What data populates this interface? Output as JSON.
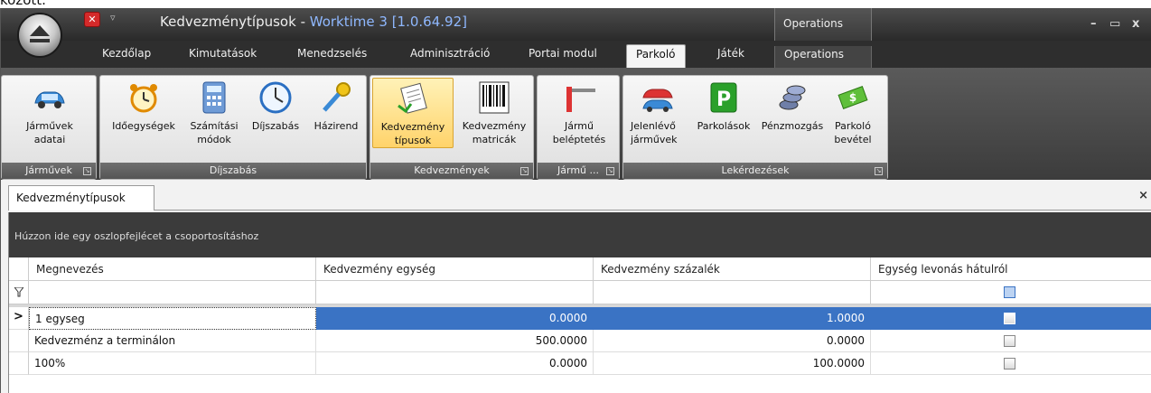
{
  "top_fragment": "között.",
  "window": {
    "title": "Kedvezménytípusok - ",
    "title_app": "Worktime 3 [1.0.64.92]",
    "context_tab": "Operations",
    "minimize": "–",
    "maximize": "▭",
    "close": "x"
  },
  "tabs": [
    {
      "label": "Kezdőlap"
    },
    {
      "label": "Kimutatások"
    },
    {
      "label": "Menedzselés"
    },
    {
      "label": "Adminisztráció"
    },
    {
      "label": "Portai modul"
    },
    {
      "label": "Parkoló",
      "active": true
    },
    {
      "label": "Játék"
    },
    {
      "label": "Operations"
    }
  ],
  "ribbon": {
    "groups": [
      {
        "label": "Járművek",
        "buttons": [
          {
            "line1": "Járművek",
            "line2": "adatai",
            "icon": "car-icon"
          }
        ]
      },
      {
        "label": "Díjszabás",
        "buttons": [
          {
            "line1": "Időegységek",
            "line2": "",
            "icon": "alarm-clock-icon"
          },
          {
            "line1": "Számítási",
            "line2": "módok",
            "icon": "calculator-icon"
          },
          {
            "line1": "Díjszabás",
            "line2": "",
            "icon": "clock-icon"
          },
          {
            "line1": "Házirend",
            "line2": "",
            "icon": "key-icon"
          }
        ]
      },
      {
        "label": "Kedvezmények",
        "buttons": [
          {
            "line1": "Kedvezmény",
            "line2": "típusok",
            "icon": "discount-document-icon",
            "active": true
          },
          {
            "line1": "Kedvezmény",
            "line2": "matricák",
            "icon": "barcode-icon"
          }
        ]
      },
      {
        "label": "Jármű ...",
        "buttons": [
          {
            "line1": "Jármű",
            "line2": "beléptetés",
            "icon": "barrier-gate-icon"
          }
        ]
      },
      {
        "label": "Lekérdezések",
        "buttons": [
          {
            "line1": "Jelenlévő",
            "line2": "járművek",
            "icon": "cars-icon"
          },
          {
            "line1": "Parkolások",
            "line2": "",
            "icon": "parking-sign-icon"
          },
          {
            "line1": "Pénzmozgás",
            "line2": "",
            "icon": "coins-icon"
          },
          {
            "line1": "Parkoló",
            "line2": "bevétel",
            "icon": "money-icon"
          }
        ]
      }
    ]
  },
  "doc_tab": {
    "label": "Kedvezménytípusok",
    "close": "×"
  },
  "grid": {
    "group_hint": "Húzzon ide egy oszlopfejlécet a csoportosításhoz",
    "columns": [
      "Megnevezés",
      "Kedvezmény egység",
      "Kedvezmény százalék",
      "Egység levonás hátulról"
    ],
    "rows": [
      {
        "name": "1 egyseg",
        "unit": "0.0000",
        "percent": "1.0000",
        "selected": true
      },
      {
        "name": "Kedvezménz a terminálon",
        "unit": "500.0000",
        "percent": "0.0000"
      },
      {
        "name": "100%",
        "unit": "0.0000",
        "percent": "100.0000"
      }
    ],
    "row_indicator": ">",
    "filter_icon": "funnel-icon"
  }
}
